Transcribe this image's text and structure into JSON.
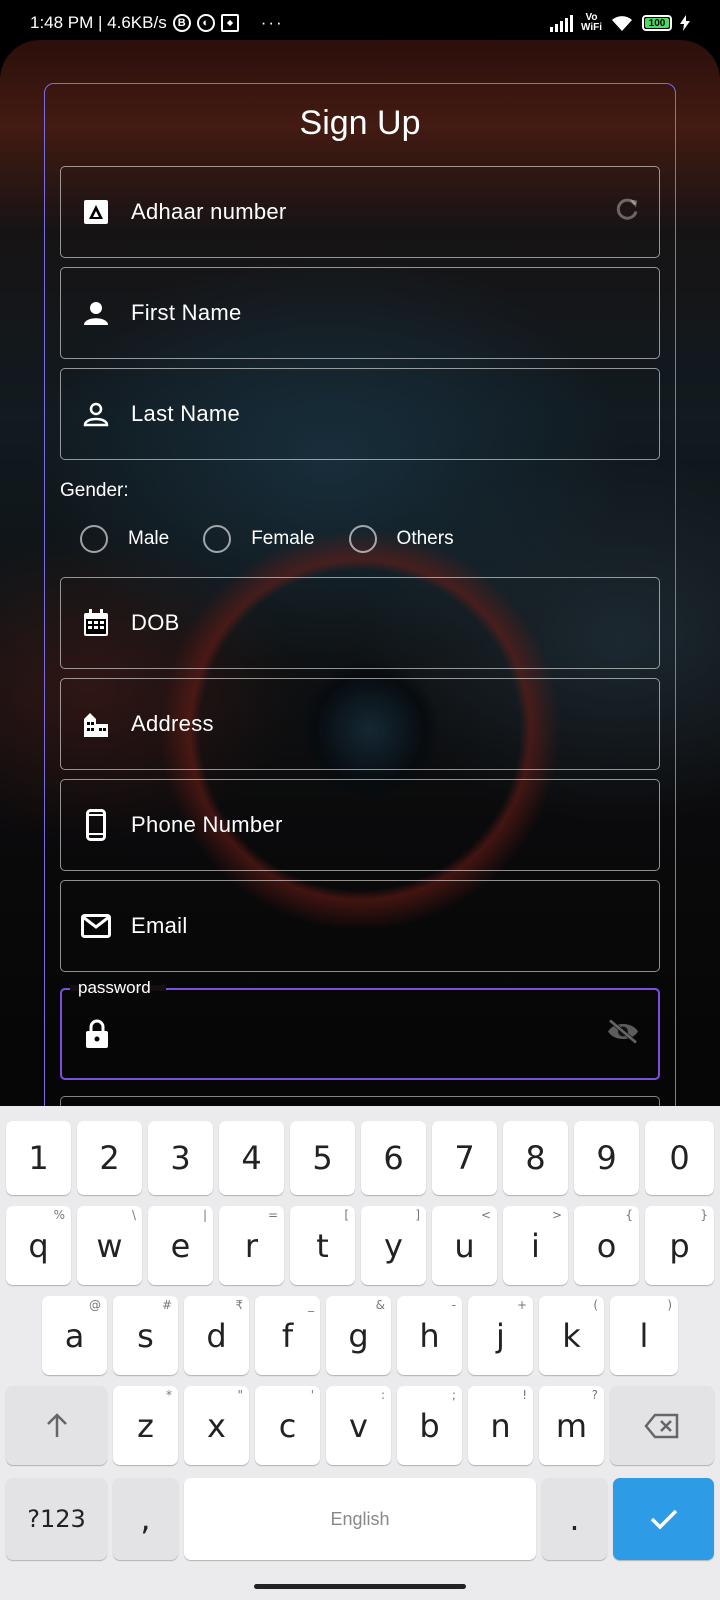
{
  "status_bar": {
    "time_speed": "1:48 PM | 4.6KB/s",
    "glyph_b": "B",
    "dots": "···",
    "vowifi_top": "Vo",
    "vowifi_bottom": "WiFi",
    "battery": "100",
    "battery_level": 1.0
  },
  "form": {
    "title": "Sign Up",
    "fields": {
      "adhaar": "Adhaar number",
      "first_name": "First Name",
      "last_name": "Last Name",
      "dob": "DOB",
      "address": "Address",
      "phone": "Phone Number",
      "email": "Email",
      "password_label": "password"
    },
    "gender": {
      "label": "Gender:",
      "options": [
        "Male",
        "Female",
        "Others"
      ]
    }
  },
  "keyboard": {
    "row1": [
      "1",
      "2",
      "3",
      "4",
      "5",
      "6",
      "7",
      "8",
      "9",
      "0"
    ],
    "row2": [
      "q",
      "w",
      "e",
      "r",
      "t",
      "y",
      "u",
      "i",
      "o",
      "p"
    ],
    "row2_hints": [
      "%",
      "\\",
      "|",
      "=",
      "[",
      "]",
      "<",
      ">",
      "{",
      "}"
    ],
    "row3": [
      "a",
      "s",
      "d",
      "f",
      "g",
      "h",
      "j",
      "k",
      "l"
    ],
    "row3_hints": [
      "@",
      "#",
      "₹",
      "_",
      "&",
      "-",
      "+",
      "(",
      ")"
    ],
    "row4": [
      "z",
      "x",
      "c",
      "v",
      "b",
      "n",
      "m"
    ],
    "row4_hints": [
      "*",
      "\"",
      "'",
      ":",
      ";",
      "!",
      "?"
    ],
    "symbols_key": "?123",
    "comma_key": ",",
    "space_label": "English",
    "period_key": ".",
    "accent_color": "#2d9be6"
  }
}
